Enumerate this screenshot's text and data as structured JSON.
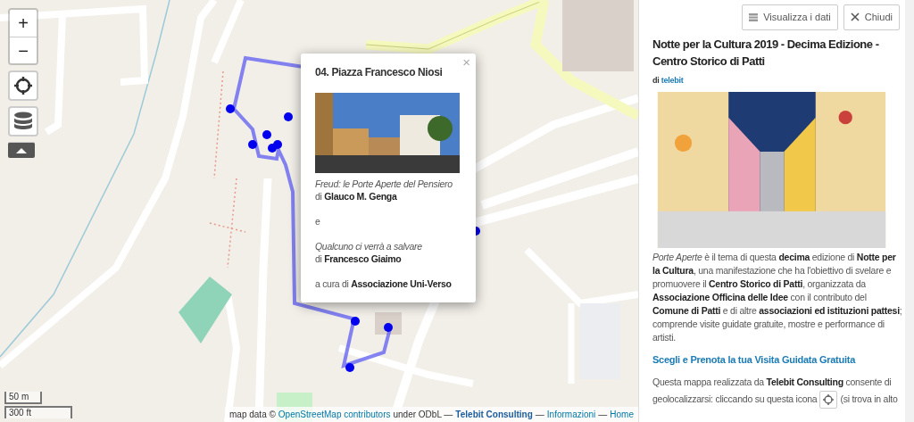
{
  "map": {
    "controls": [
      {
        "kind": "text",
        "label": "+"
      },
      {
        "kind": "text",
        "label": "−"
      },
      {
        "kind": "locate"
      },
      {
        "kind": "layers"
      },
      {
        "kind": "toggle"
      }
    ],
    "scale": [
      "50 m",
      "300 ft"
    ],
    "popup": {
      "close": "×",
      "title": "04. Piazza Francesco Niosi",
      "works": [
        {
          "title": "Freud: le Porte Aperte del Pensiero",
          "author": "di **Glauco M. Genga**"
        },
        {
          "title": "Qualcuno ci verrà a salvare",
          "author": "di **Francesco Giaimo**"
        }
      ],
      "separator": "e",
      "curator": "a cura di **Associazione Uni-Verso**"
    },
    "attribution": [
      {
        "kind": "text",
        "text": "map data ©"
      },
      {
        "kind": "link",
        "text": "OpenStreetMap contributors"
      },
      {
        "kind": "text",
        "text": "under ODbL —"
      },
      {
        "kind": "strong-link",
        "text": "Telebit Consulting"
      },
      {
        "kind": "text",
        "text": "—"
      },
      {
        "kind": "link",
        "text": "Informazioni"
      },
      {
        "kind": "text",
        "text": "—"
      },
      {
        "kind": "link",
        "text": "Home"
      }
    ]
  },
  "sidebar": {
    "buttons": [
      {
        "kind": "data",
        "label": "Visualizza i dati"
      },
      {
        "kind": "close",
        "label": "Chiudi"
      }
    ],
    "title": "Notte per la Cultura 2019 - Decima Edizione - Centro Storico di Patti",
    "byline": {
      "prefix": "di",
      "author": "telebit"
    },
    "description": "*Porte Aperte* è il tema di questa **decima** edizione di **Notte per la Cultura**, una manifestazione che ha l'obiettivo di svelare e promuovere il **Centro Storico di Patti**, organizzata da **Associazione Officina delle Idee** con il contributo del **Comune di Patti** e di altre **associazioni ed istituzioni pattesi**; comprende visite guidate gratuite, mostre e performance di artisti.",
    "booking_link": "Scegli e Prenota la tua Visita Guidata Gratuita",
    "info_first_line": "Questa mappa realizzata da **Telebit Consulting** consente di",
    "info_before_icon": "geolocalizzarsi: cliccando su questa icona",
    "info_after_icon": "(si trova in alto"
  }
}
